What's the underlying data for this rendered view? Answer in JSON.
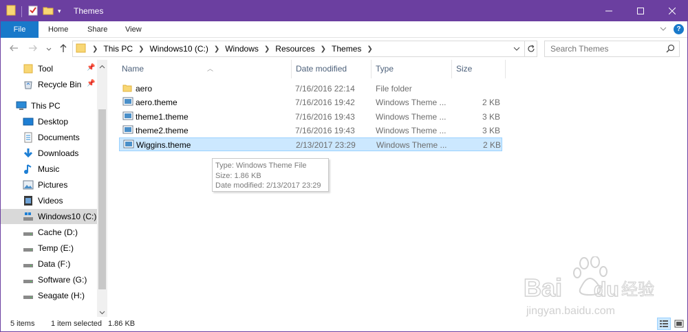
{
  "window": {
    "title": "Themes",
    "border_color": "#6b3fa0",
    "controls": {
      "minimize": "minimize-icon",
      "maximize": "maximize-icon",
      "close": "close-icon"
    }
  },
  "ribbon": {
    "tabs": [
      "File",
      "Home",
      "Share",
      "View"
    ],
    "file_color": "#1979ca",
    "help": "?"
  },
  "address": {
    "crumbs": [
      "This PC",
      "Windows10 (C:)",
      "Windows",
      "Resources",
      "Themes"
    ],
    "search_placeholder": "Search Themes"
  },
  "nav": {
    "items": [
      {
        "label": "Tool",
        "icon": "folder-icon",
        "pinned": true
      },
      {
        "label": "Recycle Bin",
        "icon": "recycle-bin-icon",
        "pinned": true
      },
      {
        "label": "This PC",
        "icon": "computer-icon"
      },
      {
        "label": "Desktop",
        "icon": "desktop-icon"
      },
      {
        "label": "Documents",
        "icon": "documents-icon"
      },
      {
        "label": "Downloads",
        "icon": "downloads-icon"
      },
      {
        "label": "Music",
        "icon": "music-icon"
      },
      {
        "label": "Pictures",
        "icon": "pictures-icon"
      },
      {
        "label": "Videos",
        "icon": "videos-icon"
      },
      {
        "label": "Windows10 (C:)",
        "icon": "drive-icon",
        "selected": true
      },
      {
        "label": "Cache (D:)",
        "icon": "drive-icon"
      },
      {
        "label": "Temp (E:)",
        "icon": "drive-icon"
      },
      {
        "label": "Data (F:)",
        "icon": "drive-icon"
      },
      {
        "label": "Software (G:)",
        "icon": "drive-icon"
      },
      {
        "label": "Seagate (H:)",
        "icon": "drive-icon"
      }
    ]
  },
  "files": {
    "columns": [
      "Name",
      "Date modified",
      "Type",
      "Size"
    ],
    "rows": [
      {
        "name": "aero",
        "date": "7/16/2016 22:14",
        "type": "File folder",
        "size": "",
        "icon": "folder-icon"
      },
      {
        "name": "aero.theme",
        "date": "7/16/2016 19:42",
        "type": "Windows Theme ...",
        "size": "2 KB",
        "icon": "theme-file-icon"
      },
      {
        "name": "theme1.theme",
        "date": "7/16/2016 19:43",
        "type": "Windows Theme ...",
        "size": "3 KB",
        "icon": "theme-file-icon"
      },
      {
        "name": "theme2.theme",
        "date": "7/16/2016 19:43",
        "type": "Windows Theme ...",
        "size": "3 KB",
        "icon": "theme-file-icon"
      },
      {
        "name": "Wiggins.theme",
        "date": "2/13/2017 23:29",
        "type": "Windows Theme ...",
        "size": "2 KB",
        "icon": "theme-file-icon",
        "selected": true
      }
    ]
  },
  "tooltip": {
    "type_line": "Type: Windows Theme File",
    "size_line": "Size: 1.86 KB",
    "date_line": "Date modified: 2/13/2017 23:29"
  },
  "status": {
    "count": "5 items",
    "selected": "1 item selected",
    "size": "1.86 KB"
  },
  "watermark": {
    "brand": "Bai",
    "brand2": "du",
    "cn": "经验",
    "url": "jingyan.baidu.com"
  }
}
